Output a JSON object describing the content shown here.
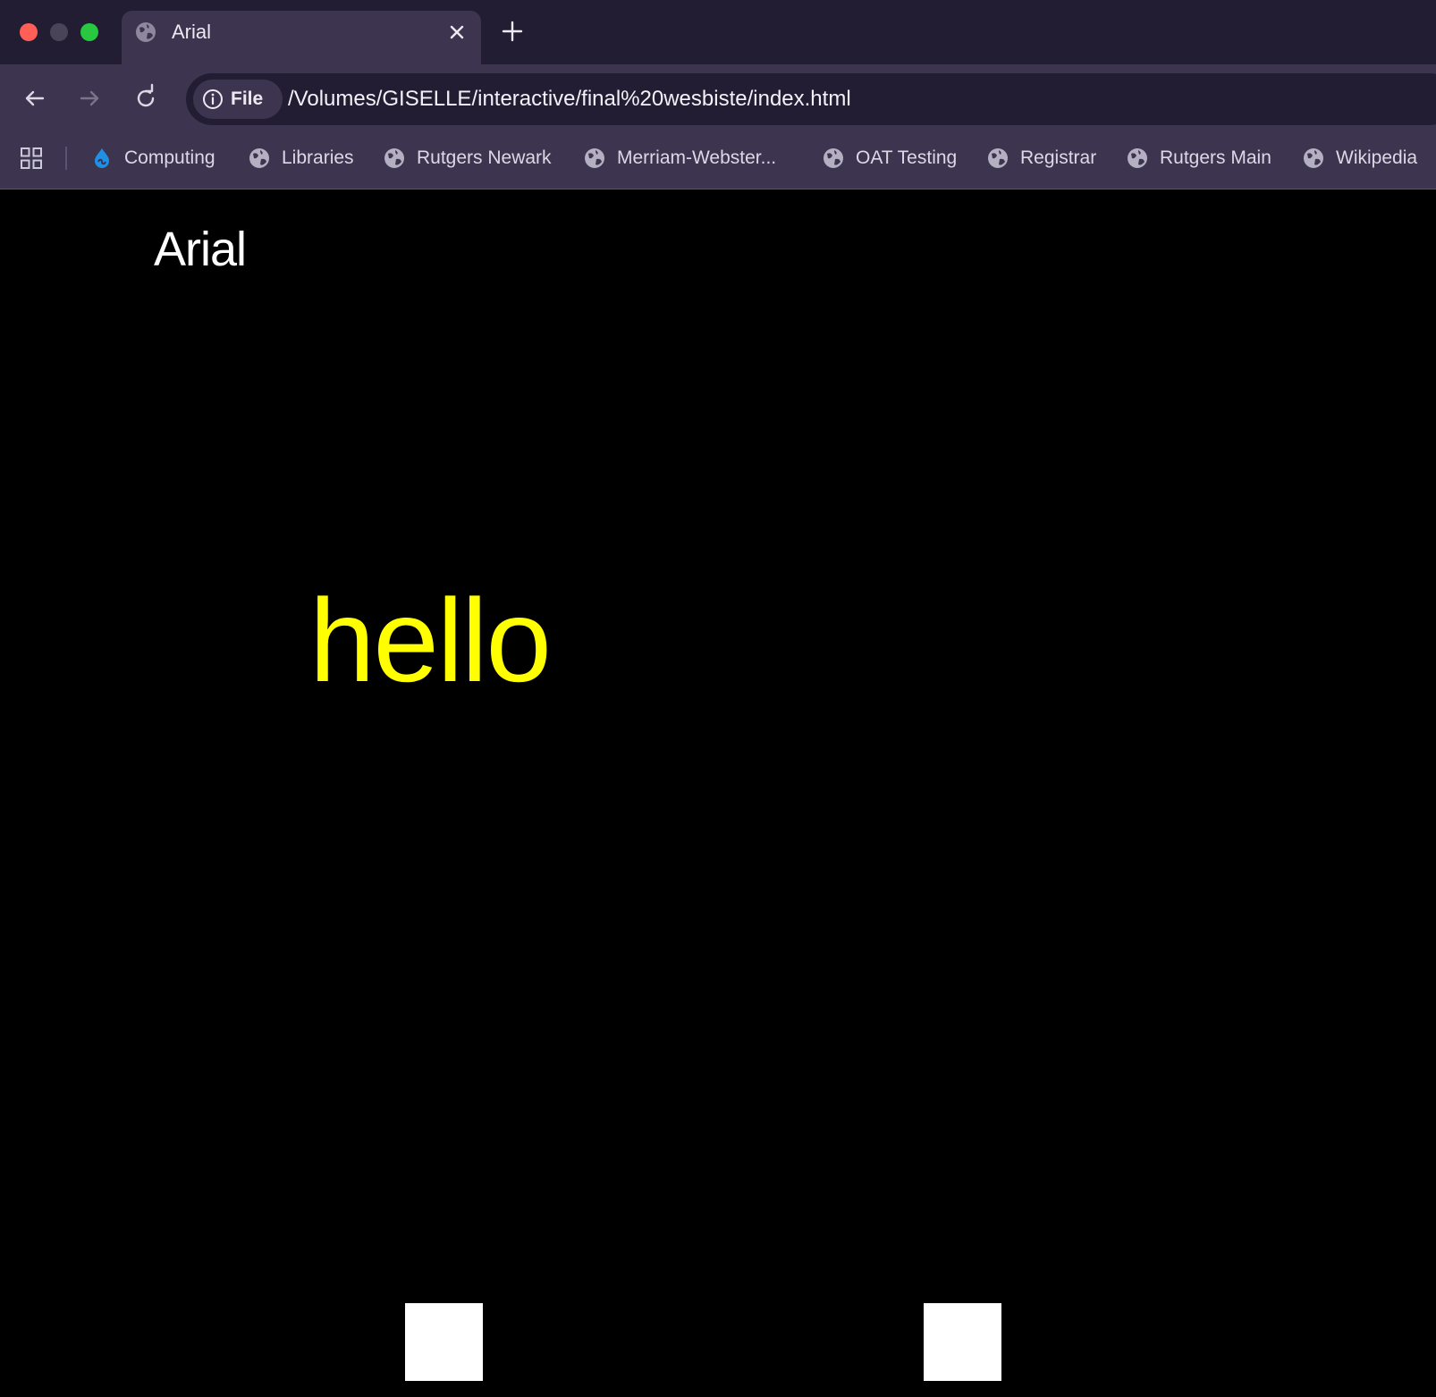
{
  "browser": {
    "tab": {
      "title": "Arial",
      "icon": "globe-icon"
    },
    "toolbar": {
      "security_chip_label": "File",
      "url": "/Volumes/GISELLE/interactive/final%20wesbiste/index.html"
    },
    "bookmarks": [
      {
        "label": "Computing",
        "icon": "drupal-drop-icon"
      },
      {
        "label": "Libraries",
        "icon": "globe-icon"
      },
      {
        "label": "Rutgers Newark",
        "icon": "globe-icon"
      },
      {
        "label": "Merriam-Webster...",
        "icon": "globe-icon"
      },
      {
        "label": "OAT Testing",
        "icon": "globe-icon"
      },
      {
        "label": "Registrar",
        "icon": "globe-icon"
      },
      {
        "label": "Rutgers Main",
        "icon": "globe-icon"
      },
      {
        "label": "Wikipedia",
        "icon": "globe-icon"
      }
    ]
  },
  "page": {
    "heading": "Arial",
    "hello_text": "hello",
    "colors": {
      "background": "#000000",
      "heading": "#ffffff",
      "hello": "#ffff00",
      "squares": "#ffffff"
    }
  }
}
